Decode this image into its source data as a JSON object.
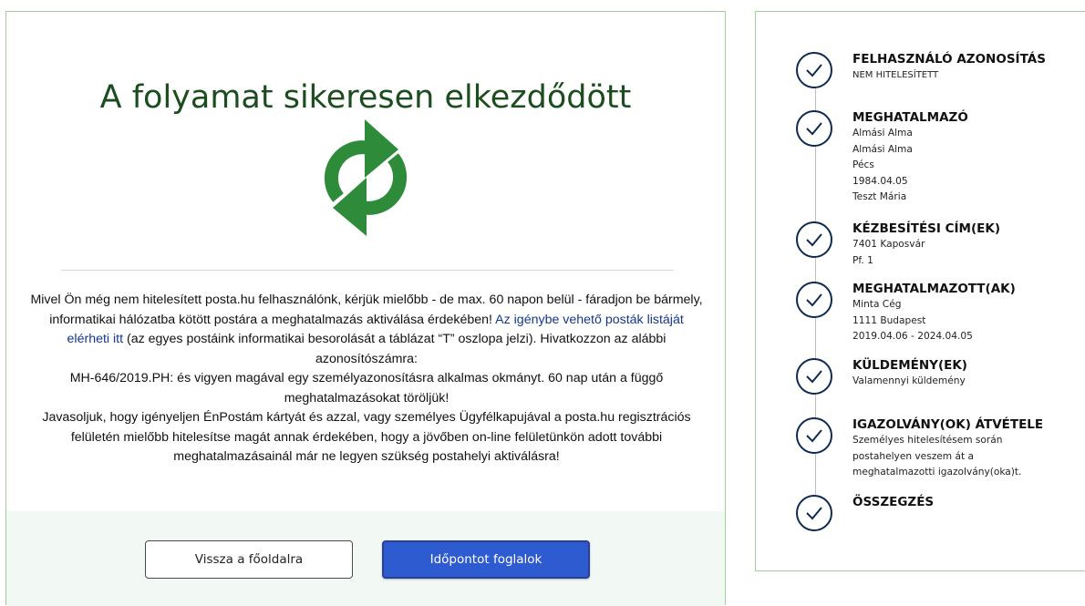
{
  "main": {
    "title": "A folyamat sikeresen elkezdődött",
    "icon": "refresh-sync-icon",
    "message": {
      "p1_before": "Mivel Ön még nem hitelesített posta.hu felhasználónk, kérjük mielőbb - de max. 60 napon belül - fáradjon be bármely, informatikai hálózatba kötött postára a meghatalmazás aktiválása érdekében! ",
      "p1_link": "Az igénybe vehető posták listáját elérheti itt",
      "p1_after": " (az egyes postáink informatikai besorolását a táblázat “T” oszlopa jelzi). Hivatkozzon az alábbi azonosítószámra:",
      "p2": "MH-646/2019.PH: és vigyen magával egy személyazonosításra alkalmas okmányt.  60 nap után a függő meghatalmazásokat töröljük!",
      "p3": "Javasoljuk, hogy igényeljen ÉnPostám kártyát és azzal, vagy személyes Ügyfélkapujával a posta.hu regisztrációs felületén mielőbb hitelesítse magát annak érdekében, hogy a jövőben on-line  felületünkön adott további meghatalmazásainál már ne legyen szükség postahelyi aktiválásra!"
    },
    "buttons": {
      "back": "Vissza a főoldalra",
      "book": "Időpontot foglalok"
    }
  },
  "colors": {
    "title_green": "#1c4d1f",
    "icon_green": "#2e8b3a",
    "link_blue": "#14388c",
    "primary_button": "#2f5bd1",
    "step_circle": "#0f2a52",
    "card_border": "#9fcf9a"
  },
  "steps": [
    {
      "title": "FELHASZNÁLÓ AZONOSÍTÁS",
      "lines": [
        "NEM HITELESÍTETT"
      ]
    },
    {
      "title": "MEGHATALMAZÓ",
      "lines": [
        "Almási Alma",
        "Almási Alma",
        "Pécs",
        "1984.04.05",
        "Teszt Mária"
      ]
    },
    {
      "title": "KÉZBESÍTÉSI CÍM(EK)",
      "lines": [
        "7401 Kaposvár",
        "Pf. 1"
      ]
    },
    {
      "title": "MEGHATALMAZOTT(AK)",
      "lines": [
        "Minta Cég",
        "1111 Budapest",
        "2019.04.06 - 2024.04.05"
      ]
    },
    {
      "title": "KÜLDEMÉNY(EK)",
      "lines": [
        "Valamennyi küldemény"
      ]
    },
    {
      "title": "IGAZOLVÁNY(OK) ÁTVÉTELE",
      "lines": [
        "Személyes hitelesítésem során",
        "postahelyen veszem át a",
        "meghatalmazotti igazolvány(oka)t."
      ]
    },
    {
      "title": "ÖSSZEGZÉS",
      "lines": []
    }
  ]
}
